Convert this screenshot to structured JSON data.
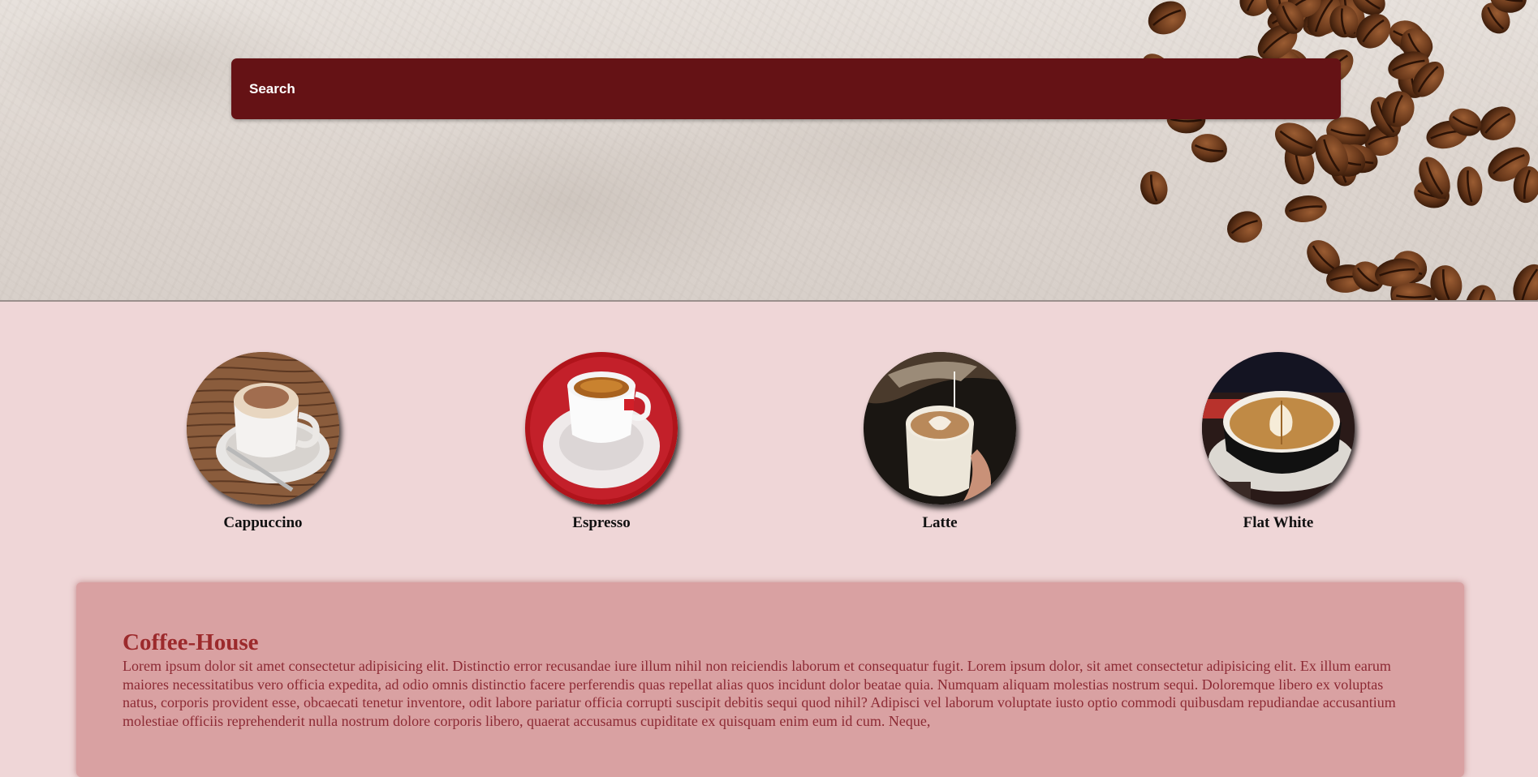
{
  "search": {
    "placeholder": "Search"
  },
  "products": [
    {
      "name": "Cappuccino",
      "icon": "cappuccino-cup-image"
    },
    {
      "name": "Espresso",
      "icon": "espresso-cup-image"
    },
    {
      "name": "Latte",
      "icon": "latte-cup-image"
    },
    {
      "name": "Flat White",
      "icon": "flat-white-cup-image"
    }
  ],
  "about": {
    "title": "Coffee-House",
    "body": "Lorem ipsum dolor sit amet consectetur adipisicing elit. Distinctio error recusandae iure illum nihil non reiciendis laborum et consequatur fugit. Lorem ipsum dolor, sit amet consectetur adipisicing elit. Ex illum earum maiores necessitatibus vero officia expedita, ad odio omnis distinctio facere perferendis quas repellat alias quos incidunt dolor beatae quia. Numquam aliquam molestias nostrum sequi. Doloremque libero ex voluptas natus, corporis provident esse, obcaecati tenetur inventore, odit labore pariatur officia corrupti suscipit debitis sequi quod nihil? Adipisci vel laborum voluptate iusto optio commodi quibusdam repudiandae accusantium molestiae officiis reprehenderit nulla nostrum dolore corporis libero, quaerat accusamus cupiditate ex quisquam enim eum id cum. Neque,"
  },
  "colors": {
    "search_bg": "#651215",
    "page_bg": "#efd6d7",
    "about_bg": "#d9a1a2",
    "about_title": "#9c2a2c",
    "about_text": "#8c2a34"
  }
}
